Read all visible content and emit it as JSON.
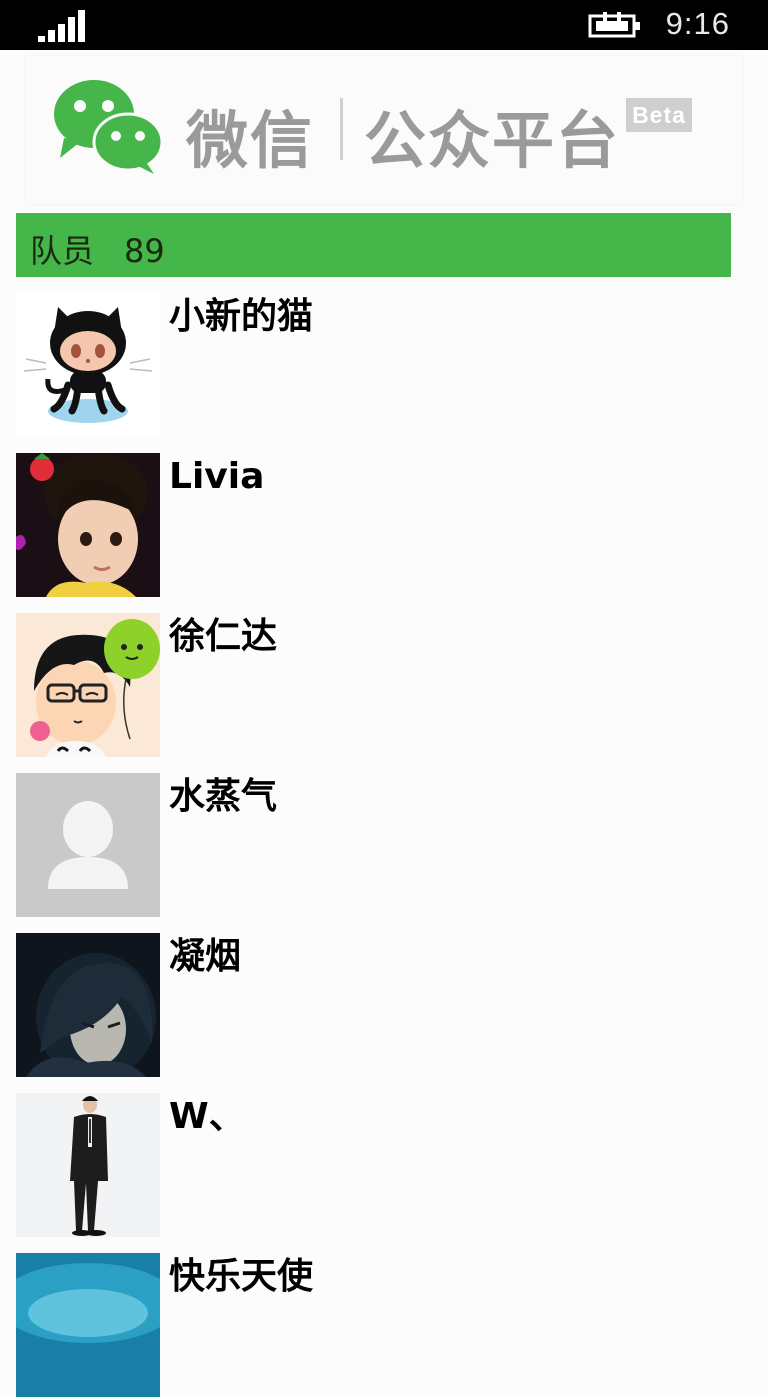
{
  "status_bar": {
    "time": "9:16",
    "signal_icon": "signal-bars-icon",
    "battery_icon": "battery-charging-icon"
  },
  "banner": {
    "brand": "微信",
    "platform": "公众平台",
    "beta": "Beta",
    "logo_icon": "wechat-logo-icon"
  },
  "section": {
    "label": "队员",
    "count": "89",
    "color": "#45b649"
  },
  "members": [
    {
      "name": "小新的猫",
      "avatar": "octocat-avatar"
    },
    {
      "name": "Livia",
      "avatar": "child-photo-avatar"
    },
    {
      "name": "徐仁达",
      "avatar": "cartoon-boy-balloon-avatar"
    },
    {
      "name": "水蒸气",
      "avatar": "default-person-avatar"
    },
    {
      "name": "凝烟",
      "avatar": "anime-character-avatar"
    },
    {
      "name": "W、",
      "avatar": "man-in-suit-avatar"
    },
    {
      "name": "快乐天使",
      "avatar": "blue-abstract-avatar"
    }
  ]
}
